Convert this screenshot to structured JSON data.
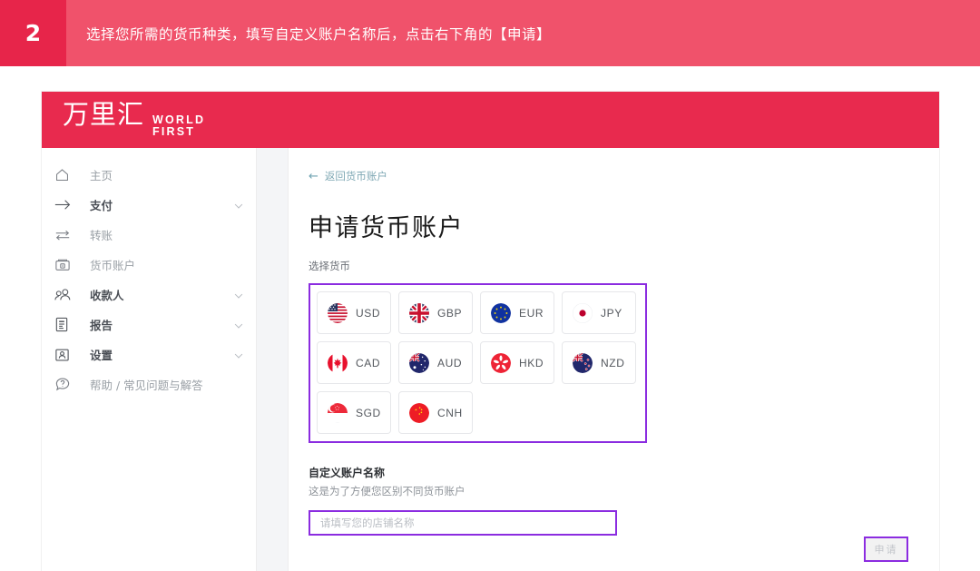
{
  "banner": {
    "step_number": "2",
    "instruction": "选择您所需的货币种类，填写自定义账户名称后，点击右下角的【申请】",
    "number_bg": "#e7254a",
    "banner_bg": "#f0526b"
  },
  "app": {
    "header_bg": "#e82a4e",
    "logo_cn": "万里汇",
    "logo_en_line1": "WORLD",
    "logo_en_line2": "FIRST"
  },
  "sidebar": {
    "items": [
      {
        "label": "主页",
        "icon": "home-icon",
        "chevron": false,
        "bold": false
      },
      {
        "label": "支付",
        "icon": "arrow-right-icon",
        "chevron": true,
        "bold": true
      },
      {
        "label": "转账",
        "icon": "transfer-icon",
        "chevron": false,
        "bold": false
      },
      {
        "label": "货币账户",
        "icon": "wallet-icon",
        "chevron": false,
        "bold": false
      },
      {
        "label": "收款人",
        "icon": "people-icon",
        "chevron": true,
        "bold": true
      },
      {
        "label": "报告",
        "icon": "report-icon",
        "chevron": true,
        "bold": true
      },
      {
        "label": "设置",
        "icon": "settings-user-icon",
        "chevron": true,
        "bold": true
      },
      {
        "label": "帮助 / 常见问题与解答",
        "icon": "help-icon",
        "chevron": false,
        "bold": false
      }
    ]
  },
  "main": {
    "back_link": "返回货币账户",
    "back_arrow": "←",
    "title": "申请货币账户",
    "currency_section_label": "选择货币",
    "currencies": [
      {
        "code": "USD",
        "flag": "flag-us"
      },
      {
        "code": "GBP",
        "flag": "flag-gb"
      },
      {
        "code": "EUR",
        "flag": "flag-eu"
      },
      {
        "code": "JPY",
        "flag": "flag-jp"
      },
      {
        "code": "CAD",
        "flag": "flag-ca"
      },
      {
        "code": "AUD",
        "flag": "flag-au"
      },
      {
        "code": "HKD",
        "flag": "flag-hk"
      },
      {
        "code": "NZD",
        "flag": "flag-nz"
      },
      {
        "code": "SGD",
        "flag": "flag-sg"
      },
      {
        "code": "CNH",
        "flag": "flag-cn"
      }
    ],
    "account_name_label": "自定义账户名称",
    "account_name_hint": "这是为了方便您区别不同货币账户",
    "account_name_value": "",
    "account_name_placeholder": "请填写您的店铺名称",
    "apply_button": "申请",
    "highlight_color": "#8b2ce0"
  }
}
